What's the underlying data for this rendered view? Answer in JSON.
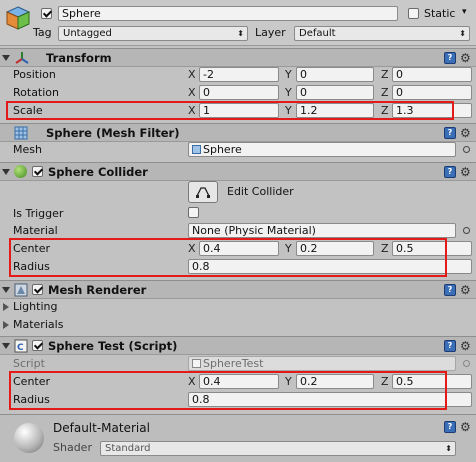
{
  "object": {
    "name": "Sphere",
    "static_label": "Static",
    "tag_label": "Tag",
    "tag_value": "Untagged",
    "layer_label": "Layer",
    "layer_value": "Default"
  },
  "transform": {
    "title": "Transform",
    "position": {
      "label": "Position",
      "x": "-2",
      "y": "0",
      "z": "0"
    },
    "rotation": {
      "label": "Rotation",
      "x": "0",
      "y": "0",
      "z": "0"
    },
    "scale": {
      "label": "Scale",
      "x": "1",
      "y": "1.2",
      "z": "1.3"
    }
  },
  "axes": {
    "x": "X",
    "y": "Y",
    "z": "Z"
  },
  "mesh_filter": {
    "title": "Sphere (Mesh Filter)",
    "mesh_label": "Mesh",
    "mesh_value": "Sphere"
  },
  "sphere_collider": {
    "title": "Sphere Collider",
    "edit_label": "Edit Collider",
    "trigger_label": "Is Trigger",
    "material_label": "Material",
    "material_value": "None (Physic Material)",
    "center_label": "Center",
    "cx": "0.4",
    "cy": "0.2",
    "cz": "0.5",
    "radius_label": "Radius",
    "radius": "0.8"
  },
  "mesh_renderer": {
    "title": "Mesh Renderer",
    "lighting": "Lighting",
    "materials": "Materials"
  },
  "sphere_test": {
    "title": "Sphere Test (Script)",
    "script_label": "Script",
    "script_value": "SphereTest",
    "center_label": "Center",
    "cx": "0.4",
    "cy": "0.2",
    "cz": "0.5",
    "radius_label": "Radius",
    "radius": "0.8"
  },
  "material": {
    "name": "Default-Material",
    "shader_label": "Shader",
    "shader_value": "Standard"
  },
  "icons": {
    "help": "?",
    "gear": "⚙"
  },
  "colors": {
    "highlight": "#e21a1a",
    "header": "#b6b6b6",
    "background": "#c2c2c2"
  }
}
